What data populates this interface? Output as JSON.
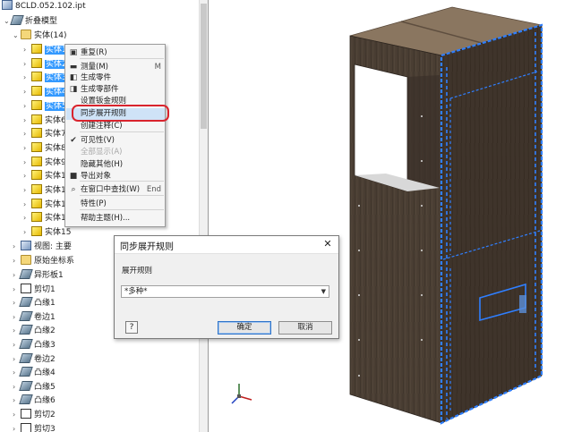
{
  "browser": {
    "file_name": "8CLD.052.102.ipt",
    "root_label": "折叠模型",
    "solids_label": "实体(14)",
    "solid_items": [
      "实体1",
      "实体2",
      "实体3",
      "实体4",
      "实体5",
      "实体6",
      "实体7",
      "实体8",
      "实体9",
      "实体10",
      "实体11",
      "实体12",
      "实体13",
      "实体15"
    ],
    "view_label": "视图: 主要",
    "origin_label": "原始坐标系",
    "features": [
      "异形板1",
      "剪切1",
      "凸缘1",
      "卷边1",
      "凸缘2",
      "凸缘3",
      "卷边2",
      "凸缘4",
      "凸缘5",
      "凸缘6",
      "剪切2",
      "剪切3"
    ]
  },
  "context_menu": {
    "items": [
      {
        "label": "重复(R)",
        "icon": "repeat-icon",
        "enabled": true
      },
      {
        "label": "测量(M)",
        "icon": "measure-icon",
        "enabled": true,
        "shortcut": "M"
      },
      {
        "label": "生成零件",
        "icon": "make-part-icon",
        "enabled": true
      },
      {
        "label": "生成零部件",
        "icon": "make-components-icon",
        "enabled": true
      },
      {
        "label": "设置钣金规则",
        "icon": "",
        "enabled": true
      },
      {
        "label": "同步展开规则",
        "icon": "",
        "enabled": true,
        "highlighted": true
      },
      {
        "label": "创建注释(C)",
        "icon": "",
        "enabled": true
      },
      {
        "label": "可见性(V)",
        "icon": "check-icon",
        "enabled": true
      },
      {
        "label": "全部显示(A)",
        "icon": "",
        "enabled": false
      },
      {
        "label": "隐藏其他(H)",
        "icon": "",
        "enabled": true
      },
      {
        "label": "导出对象",
        "icon": "export-icon",
        "enabled": true
      },
      {
        "label": "在窗口中查找(W)",
        "icon": "find-icon",
        "enabled": true,
        "shortcut": "End"
      },
      {
        "label": "特性(P)",
        "icon": "",
        "enabled": true
      },
      {
        "label": "帮助主题(H)...",
        "icon": "",
        "enabled": true
      }
    ]
  },
  "dialog": {
    "title": "同步展开规则",
    "field_label": "展开规则",
    "combo_value": "*多种*",
    "help_label": "?",
    "ok_label": "确定",
    "cancel_label": "取消"
  },
  "colors": {
    "selection_blue": "#3399ff",
    "highlight_ring": "#d9232d",
    "wood_dark": "#4a3e33",
    "wood_top": "#8a7660",
    "edge_highlight": "#2f7fff"
  }
}
